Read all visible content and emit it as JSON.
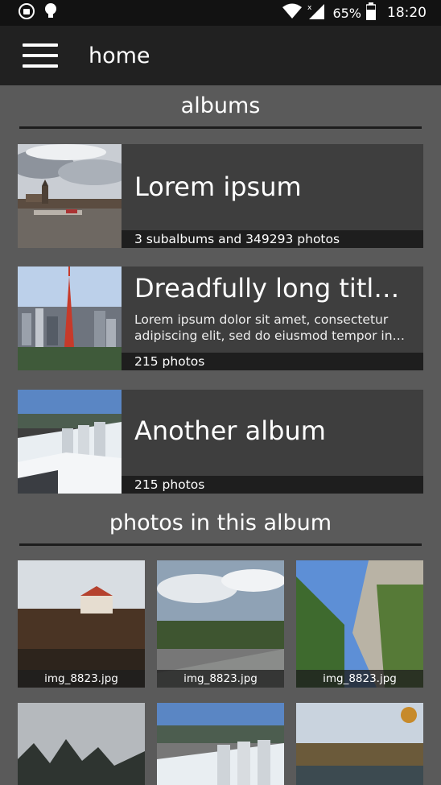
{
  "status_bar": {
    "battery_percent": "65%",
    "time": "18:20",
    "icons": [
      "android-badge-icon",
      "lightbulb-icon",
      "wifi-icon",
      "signal-icon",
      "battery-icon"
    ]
  },
  "app_bar": {
    "title": "home",
    "menu_icon": "hamburger-menu-icon"
  },
  "albums_section": {
    "title": "albums",
    "items": [
      {
        "title": "Lorem ipsum",
        "description": [],
        "count": "3 subalbums and 349293 photos"
      },
      {
        "title": "Dreadfully long titl…",
        "description": [
          "Lorem ipsum dolor sit amet, consectetur",
          "adipiscing elit, sed do eiusmod tempor in…"
        ],
        "count": "215 photos"
      },
      {
        "title": "Another album",
        "description": [],
        "count": "215 photos"
      }
    ]
  },
  "photos_section": {
    "title": "photos in this album",
    "items": [
      {
        "caption": "img_8823.jpg"
      },
      {
        "caption": "img_8823.jpg"
      },
      {
        "caption": "img_8823.jpg"
      },
      {
        "caption": ""
      },
      {
        "caption": ""
      },
      {
        "caption": ""
      }
    ]
  },
  "colors": {
    "background": "#5a5a5a",
    "status_bar": "#121212",
    "app_bar": "#212121",
    "card": "#3e3e3e",
    "caption_strip": "#1e1e1e"
  }
}
